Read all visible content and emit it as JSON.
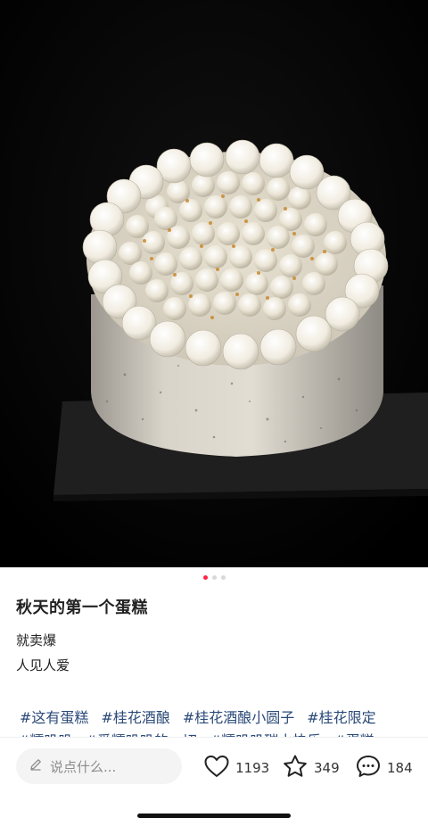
{
  "post": {
    "image_description_alt": "",
    "carousel": {
      "count": 3,
      "active_index": 0
    },
    "title": "秋天的第一个蛋糕",
    "body_lines": [
      "就卖爆",
      "人见人爱"
    ],
    "tags_row1": [
      "#这有蛋糕",
      "#桂花酒酿",
      "#桂花酒酿小圆子",
      "#桂花限定"
    ],
    "tags_row2": [
      "#糯叽叽",
      "#爱糯叽叽的一切",
      "#糯叽叽碳水快乐",
      "#蛋糕"
    ]
  },
  "bottom_bar": {
    "comment_placeholder": "说点什么...",
    "likes": "1193",
    "favorites": "349",
    "comments": "184"
  },
  "colors": {
    "accent": "#ff2442",
    "tag": "#2b4a78",
    "background": "#ffffff"
  },
  "icons": {
    "pencil": "pencil-icon",
    "like": "heart-icon",
    "favorite": "star-icon",
    "comment": "chat-bubble-icon"
  }
}
